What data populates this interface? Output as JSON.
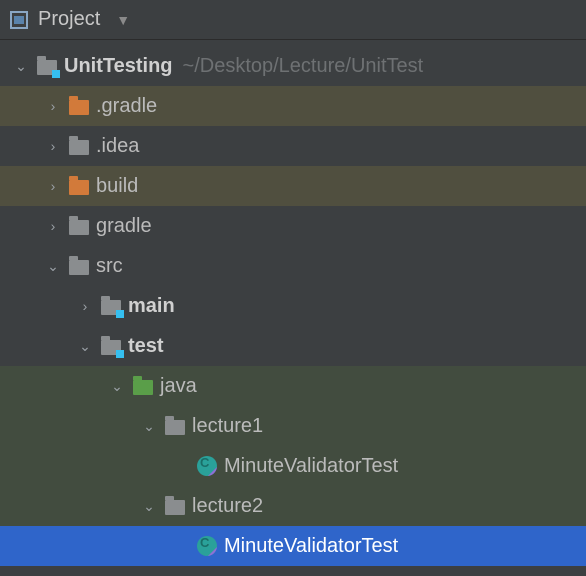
{
  "header": {
    "title": "Project"
  },
  "tree": {
    "root": {
      "name": "UnitTesting",
      "path": "~/Desktop/Lecture/UnitTest"
    },
    "gradle_hidden": ".gradle",
    "idea_hidden": ".idea",
    "build": "build",
    "gradle": "gradle",
    "src": "src",
    "main": "main",
    "test": "test",
    "java": "java",
    "lecture1": "lecture1",
    "lecture1_file": "MinuteValidatorTest",
    "lecture2": "lecture2",
    "lecture2_file": "MinuteValidatorTest"
  }
}
